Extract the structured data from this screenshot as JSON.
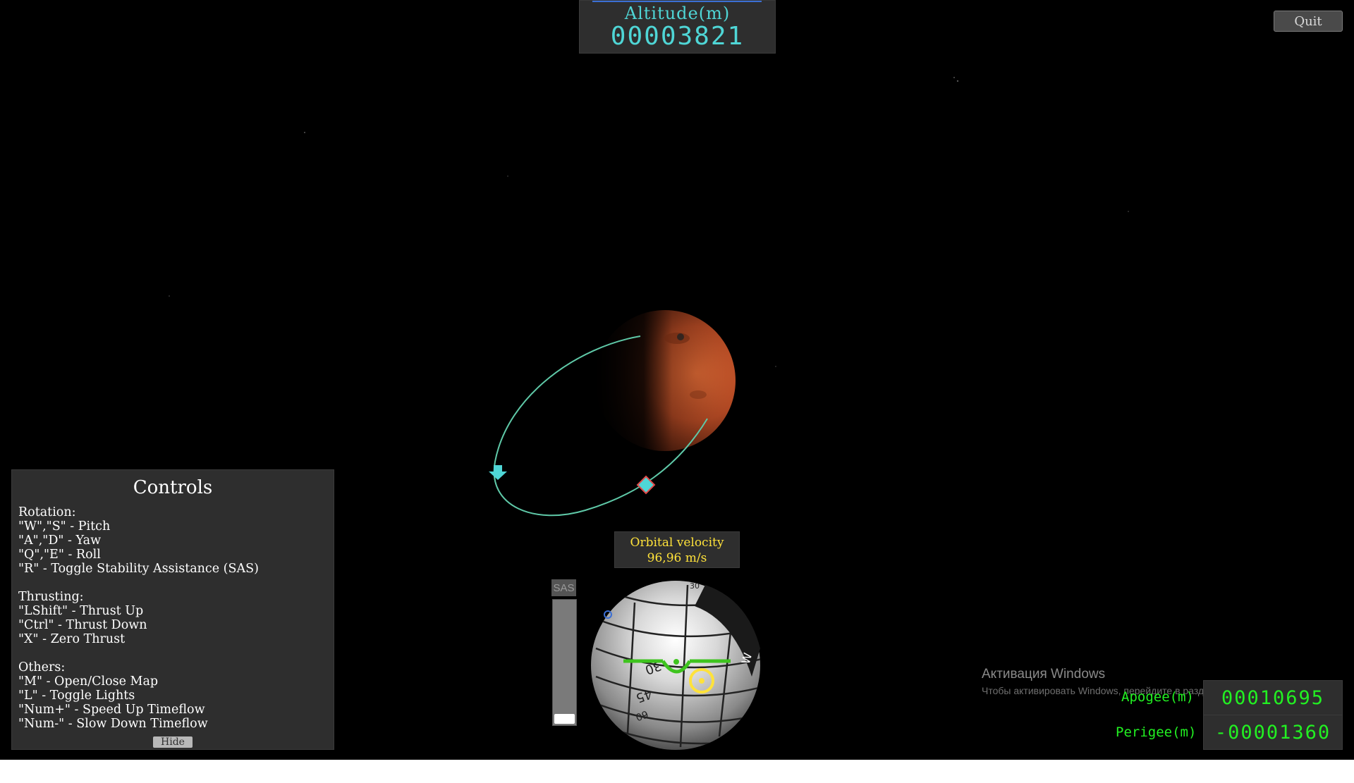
{
  "hud": {
    "altitude_label": "Altitude(m)",
    "altitude_value": "00003821",
    "quit_label": "Quit"
  },
  "controls": {
    "title": "Controls",
    "lines": [
      "Rotation:",
      "\"W\",\"S\" - Pitch",
      "\"A\",\"D\" - Yaw",
      "\"Q\",\"E\" - Roll",
      "\"R\" - Toggle Stability Assistance (SAS)",
      "",
      "Thrusting:",
      "\"LShift\" - Thrust Up",
      "\"Ctrl\" - Thrust Down",
      "\"X\" - Zero Thrust",
      "",
      "Others:",
      "\"M\" - Open/Close Map",
      "\"L\" - Toggle Lights",
      "\"Num+\" - Speed Up Timeflow",
      "\"Num-\" - Slow Down Timeflow"
    ],
    "hide_label": "Hide"
  },
  "velocity": {
    "label": "Orbital velocity",
    "value": "96,96 m/s"
  },
  "sas": {
    "label": "SAS",
    "thrust_level": 0.06
  },
  "navball": {
    "labels": [
      "30",
      "45",
      "60",
      "30",
      "W"
    ]
  },
  "orbit": {
    "apogee_label": "Apogee(m)",
    "apogee_value": "00010695",
    "perigee_label": "Perigee(m)",
    "perigee_value": "-00001360"
  },
  "windows_watermark": {
    "title": "Активация Windows",
    "subtitle": "Чтобы активировать Windows, перейдите в раздел \"Параметры\"."
  },
  "colors": {
    "hud_cyan": "#4fd6d6",
    "velocity_yellow": "#ffe23a",
    "stat_green": "#22f022",
    "orbit_line": "#5fc9a8",
    "planet": "#c8552a"
  }
}
